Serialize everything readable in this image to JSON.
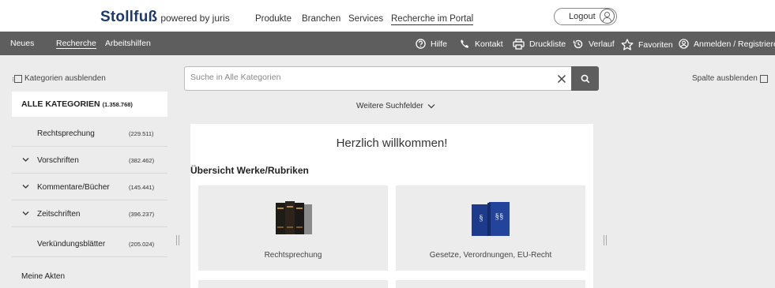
{
  "header": {
    "brand": "Stollfuß",
    "brand_sub": "powered by juris",
    "nav": [
      "Produkte",
      "Branchen",
      "Services",
      "Recherche im Portal"
    ],
    "logout_label": "Logout"
  },
  "navbar": {
    "left": [
      "Neues",
      "Recherche",
      "Arbeitshilfen"
    ],
    "active": "Recherche",
    "right": [
      {
        "label": "Hilfe",
        "icon": "help-icon"
      },
      {
        "label": "Kontakt",
        "icon": "phone-icon"
      },
      {
        "label": "Druckliste",
        "icon": "printer-icon"
      },
      {
        "label": "Verlauf",
        "icon": "history-icon"
      },
      {
        "label": "Favoriten",
        "icon": "star-icon"
      },
      {
        "label": "Anmelden / Registrieren",
        "icon": "user-icon"
      }
    ]
  },
  "sidebar": {
    "hide_label": "Kategorien ausblenden",
    "all": {
      "label": "ALLE KATEGORIEN",
      "count": "(1.358.768)"
    },
    "items": [
      {
        "label": "Rechtsprechung",
        "count": "(229.511)",
        "expandable": false
      },
      {
        "label": "Vorschriften",
        "count": "(382.462)",
        "expandable": true
      },
      {
        "label": "Kommentare/Bücher",
        "count": "(145.441)",
        "expandable": true
      },
      {
        "label": "Zeitschriften",
        "count": "(396.237)",
        "expandable": true
      },
      {
        "label": "Verkündungsblätter",
        "count": "(205.024)",
        "expandable": false
      }
    ],
    "my_files": "Meine Akten"
  },
  "right_column": {
    "hide_label": "Spalte ausblenden"
  },
  "search": {
    "placeholder": "Suche in Alle Kategorien",
    "value": "",
    "more_fields": "Weitere Suchfelder"
  },
  "welcome": {
    "title": "Herzlich willkommen!",
    "overview": "Übersicht Werke/Rubriken",
    "tiles": [
      {
        "caption": "Rechtsprechung"
      },
      {
        "caption": "Gesetze, Verordnungen, EU-Recht"
      }
    ]
  },
  "colors": {
    "navbar": "#5e5e5e",
    "brand": "#1d3a6b",
    "background": "#ececec"
  }
}
